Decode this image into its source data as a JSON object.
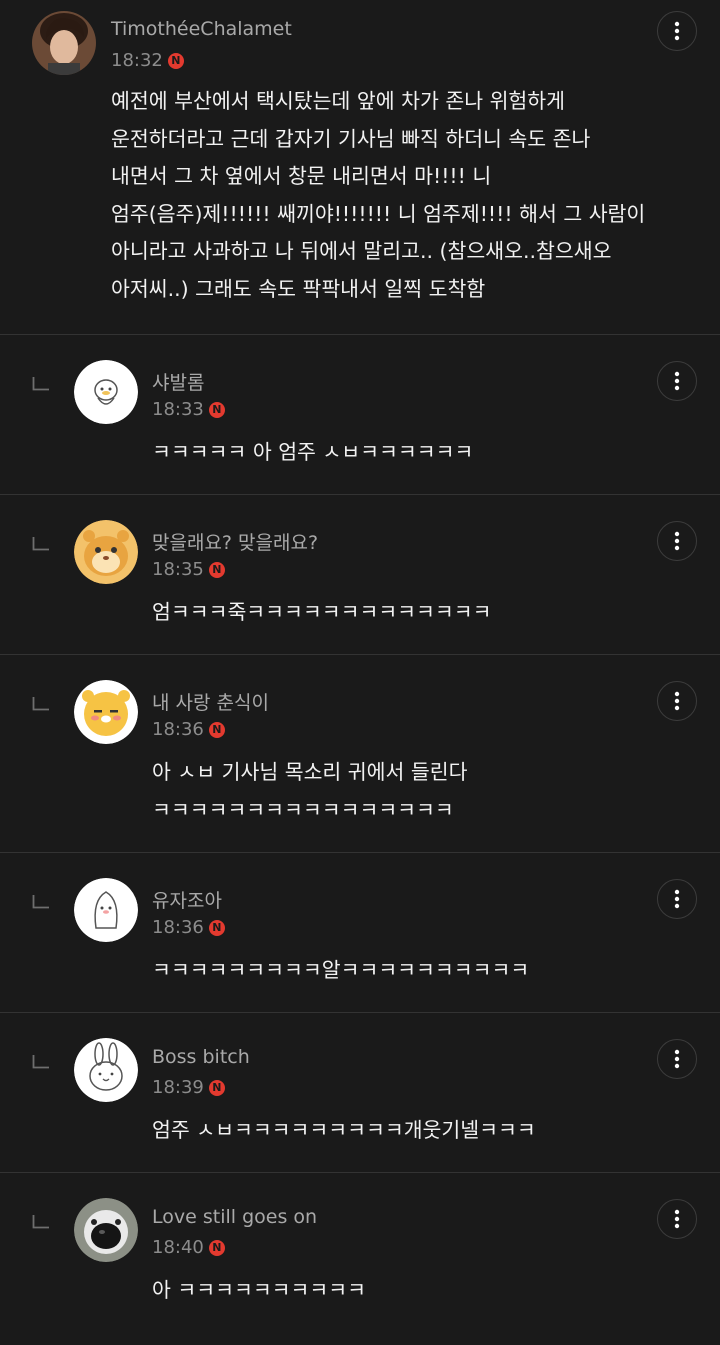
{
  "post": {
    "author": "TimothéeChalamet",
    "time": "18:32",
    "badge": "N",
    "lines": [
      "예전에 부산에서 택시탔는데 앞에 차가 존나 위험하게",
      "운전하더라고 근데 갑자기 기사님 빠직 하더니 속도 존나",
      "내면서 그 차 옆에서 창문 내리면서 마!!!! 니",
      "엄주(음주)제!!!!!! 쌔끼야!!!!!!! 니 엄주제!!!! 해서 그 사람이",
      "아니라고 사과하고 나 뒤에서 말리고.. (참으새오..참으새오",
      "아저씨..) 그래도 속도 팍팍내서 일찍 도착함"
    ]
  },
  "replies": [
    {
      "author": "샤발롬",
      "time": "18:33",
      "badge": "N",
      "lines": [
        "ㅋㅋㅋㅋㅋ 아 엄주 ㅅㅂㅋㅋㅋㅋㅋㅋ"
      ]
    },
    {
      "author": "맞을래요? 맞을래요?",
      "time": "18:35",
      "badge": "N",
      "lines": [
        "엄ㅋㅋㅋ죽ㅋㅋㅋㅋㅋㅋㅋㅋㅋㅋㅋㅋㅋ"
      ]
    },
    {
      "author": "내 사랑 춘식이",
      "time": "18:36",
      "badge": "N",
      "lines": [
        "아 ㅅㅂ 기사님 목소리 귀에서 들린다",
        "ㅋㅋㅋㅋㅋㅋㅋㅋㅋㅋㅋㅋㅋㅋㅋㅋ"
      ]
    },
    {
      "author": "유자조아",
      "time": "18:36",
      "badge": "N",
      "lines": [
        "ㅋㅋㅋㅋㅋㅋㅋㅋㅋ알ㅋㅋㅋㅋㅋㅋㅋㅋㅋㅋ"
      ]
    },
    {
      "author": "Boss bitch",
      "time": "18:39",
      "badge": "N",
      "lines": [
        "엄주 ㅅㅂㅋㅋㅋㅋㅋㅋㅋㅋㅋ개웃기넬ㅋㅋㅋ"
      ]
    },
    {
      "author": "Love still goes on",
      "time": "18:40",
      "badge": "N",
      "lines": [
        "아 ㅋㅋㅋㅋㅋㅋㅋㅋㅋㅋ"
      ]
    }
  ],
  "icons": {
    "more": "more-vertical-icon",
    "reply": "reply-arrow-icon",
    "badge": "new-badge"
  },
  "colors": {
    "background": "#1a1a1a",
    "badge": "#e33a2f",
    "name": "#a9a9a9"
  }
}
